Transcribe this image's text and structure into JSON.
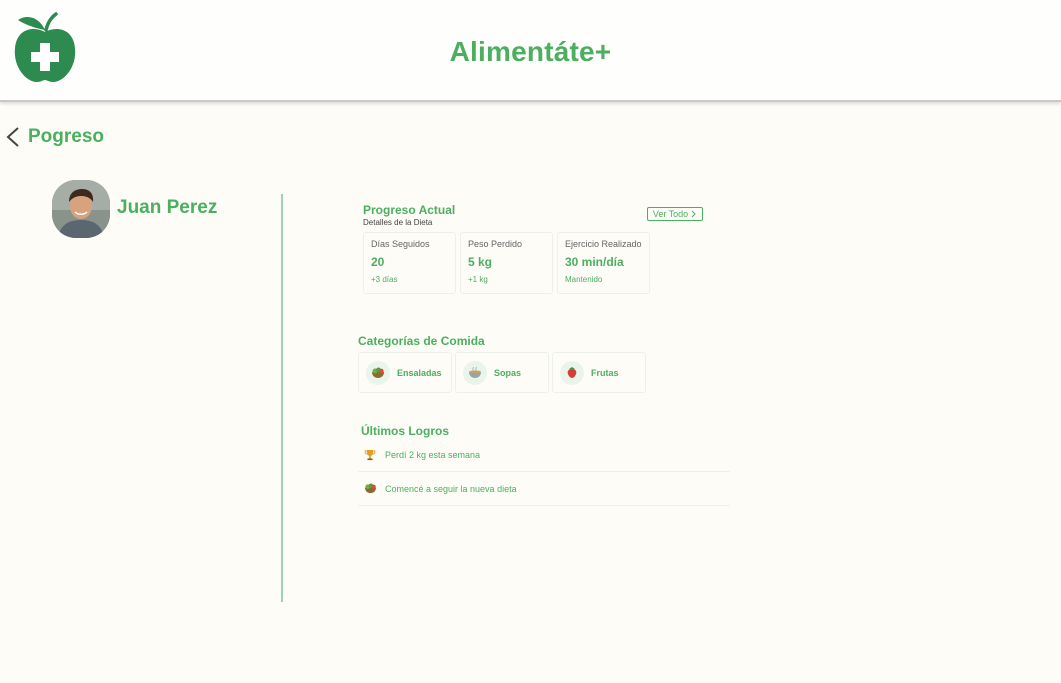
{
  "header": {
    "title": "Alimentáte+",
    "logo_icon": "apple-plus-icon"
  },
  "nav": {
    "back_label": "Pogreso"
  },
  "profile": {
    "name": "Juan Perez"
  },
  "progress": {
    "title": "Progreso Actual",
    "subtitle": "Detalles de la Dieta",
    "view_all_label": "Ver Todo",
    "stats": [
      {
        "label": "Días Seguidos",
        "value": "20",
        "delta": "+3 días"
      },
      {
        "label": "Peso Perdido",
        "value": "5 kg",
        "delta": "+1 kg"
      },
      {
        "label": "Ejercicio Realizado",
        "value": "30 min/día",
        "delta": "Mantenido"
      }
    ]
  },
  "categories": {
    "title": "Categorías de Comida",
    "items": [
      {
        "label": "Ensaladas",
        "icon": "salad-bowl-icon"
      },
      {
        "label": "Sopas",
        "icon": "soup-bowl-icon"
      },
      {
        "label": "Frutas",
        "icon": "strawberry-icon"
      }
    ]
  },
  "achievements": {
    "title": "Últimos Logros",
    "items": [
      {
        "text": "Perdí 2 kg esta semana",
        "icon": "trophy-icon"
      },
      {
        "text": "Comencé a seguir la nueva dieta",
        "icon": "salad-bowl-icon"
      }
    ]
  },
  "colors": {
    "accent": "#4caf60",
    "background": "#fdfcf7",
    "logo_green": "#2e8b4f"
  }
}
